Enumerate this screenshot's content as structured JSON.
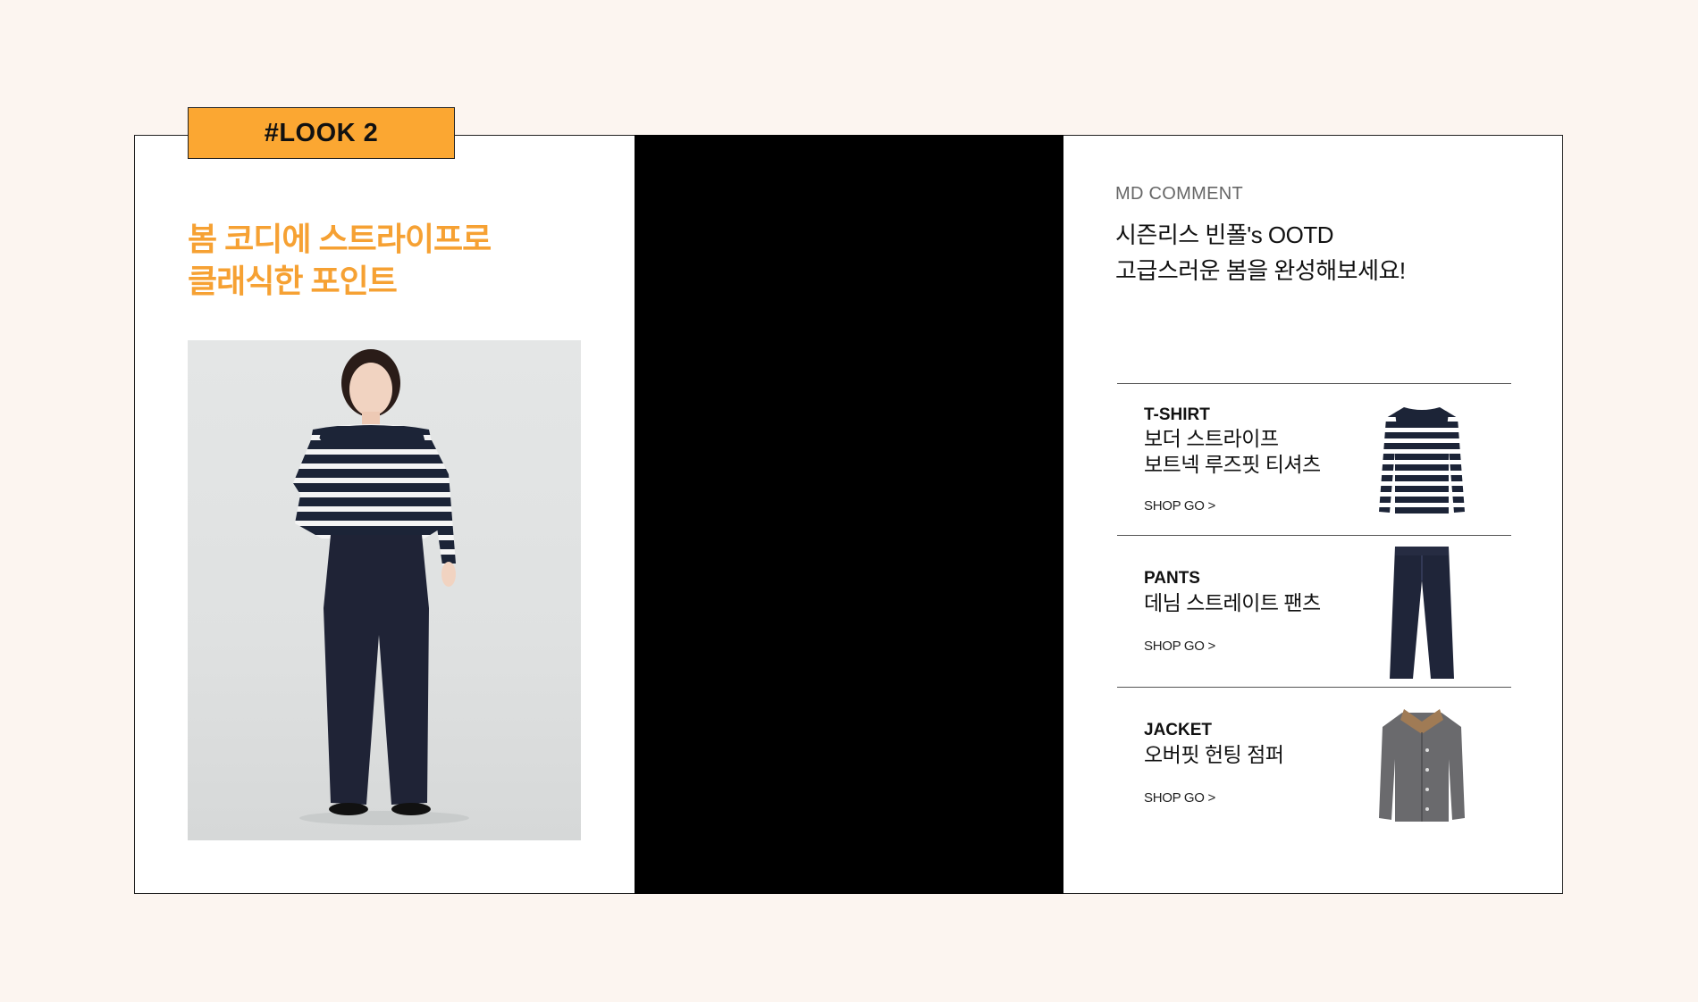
{
  "look_tag": "#LOOK 2",
  "headline": [
    "봄 코디에 스트라이프로",
    "클래식한 포인트"
  ],
  "md_comment": {
    "label": "MD COMMENT",
    "lines": [
      "시즌리스 빈폴's OOTD",
      "고급스러운 봄을 완성해보세요!"
    ]
  },
  "products": [
    {
      "category": "T-SHIRT",
      "name_lines": [
        "보더 스트라이프",
        "보트넥 루즈핏 티셔츠"
      ],
      "link": "SHOP GO >",
      "icon": "striped-tshirt"
    },
    {
      "category": "PANTS",
      "name_lines": [
        "데님 스트레이트 팬츠"
      ],
      "link": "SHOP GO >",
      "icon": "denim-pants"
    },
    {
      "category": "JACKET",
      "name_lines": [
        "오버핏 헌팅 점퍼"
      ],
      "link": "SHOP GO >",
      "icon": "gray-jacket"
    }
  ],
  "colors": {
    "accent": "#fba732",
    "headline": "#f6a133",
    "background": "#fcf5f0"
  }
}
